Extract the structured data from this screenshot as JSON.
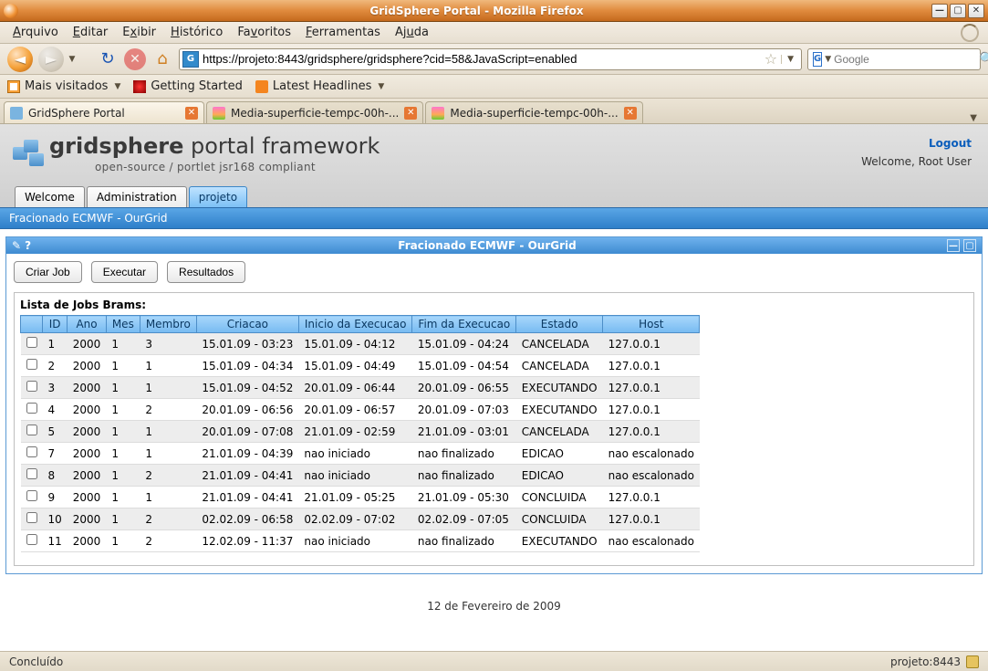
{
  "window": {
    "title": "GridSphere Portal - Mozilla Firefox"
  },
  "menu": [
    "Arquivo",
    "Editar",
    "Exibir",
    "Histórico",
    "Favoritos",
    "Ferramentas",
    "Ajuda"
  ],
  "url": "https://projeto:8443/gridsphere/gridsphere?cid=58&JavaScript=enabled",
  "search": {
    "placeholder": "Google"
  },
  "bookmarks": {
    "most": "Mais visitados",
    "started": "Getting Started",
    "headlines": "Latest Headlines"
  },
  "tabs": [
    {
      "label": "GridSphere Portal"
    },
    {
      "label": "Media-superficie-tempc-00h-..."
    },
    {
      "label": "Media-superficie-tempc-00h-..."
    }
  ],
  "gs": {
    "title_bold": "gridsphere",
    "title_rest": " portal framework",
    "subtitle": "open-source / portlet jsr168 compliant",
    "logout": "Logout",
    "welcome": "Welcome, Root User",
    "nav": [
      "Welcome",
      "Administration",
      "projeto"
    ],
    "nav_active": 2,
    "breadcrumb": "Fracionado ECMWF - OurGrid"
  },
  "portlet": {
    "title": "Fracionado ECMWF - OurGrid",
    "buttons": [
      "Criar Job",
      "Executar",
      "Resultados"
    ],
    "list_label": "Lista de Jobs Brams:",
    "headers": [
      "",
      "ID",
      "Ano",
      "Mes",
      "Membro",
      "Criacao",
      "Inicio da Execucao",
      "Fim da Execucao",
      "Estado",
      "Host"
    ],
    "rows": [
      {
        "id": "1",
        "ano": "2000",
        "mes": "1",
        "membro": "3",
        "criacao": "15.01.09 - 03:23",
        "inicio": "15.01.09 - 04:12",
        "fim": "15.01.09 - 04:24",
        "estado": "CANCELADA",
        "host": "127.0.0.1"
      },
      {
        "id": "2",
        "ano": "2000",
        "mes": "1",
        "membro": "1",
        "criacao": "15.01.09 - 04:34",
        "inicio": "15.01.09 - 04:49",
        "fim": "15.01.09 - 04:54",
        "estado": "CANCELADA",
        "host": "127.0.0.1"
      },
      {
        "id": "3",
        "ano": "2000",
        "mes": "1",
        "membro": "1",
        "criacao": "15.01.09 - 04:52",
        "inicio": "20.01.09 - 06:44",
        "fim": "20.01.09 - 06:55",
        "estado": "EXECUTANDO",
        "host": "127.0.0.1"
      },
      {
        "id": "4",
        "ano": "2000",
        "mes": "1",
        "membro": "2",
        "criacao": "20.01.09 - 06:56",
        "inicio": "20.01.09 - 06:57",
        "fim": "20.01.09 - 07:03",
        "estado": "EXECUTANDO",
        "host": "127.0.0.1"
      },
      {
        "id": "5",
        "ano": "2000",
        "mes": "1",
        "membro": "1",
        "criacao": "20.01.09 - 07:08",
        "inicio": "21.01.09 - 02:59",
        "fim": "21.01.09 - 03:01",
        "estado": "CANCELADA",
        "host": "127.0.0.1"
      },
      {
        "id": "7",
        "ano": "2000",
        "mes": "1",
        "membro": "1",
        "criacao": "21.01.09 - 04:39",
        "inicio": "nao iniciado",
        "fim": "nao finalizado",
        "estado": "EDICAO",
        "host": "nao escalonado"
      },
      {
        "id": "8",
        "ano": "2000",
        "mes": "1",
        "membro": "2",
        "criacao": "21.01.09 - 04:41",
        "inicio": "nao iniciado",
        "fim": "nao finalizado",
        "estado": "EDICAO",
        "host": "nao escalonado"
      },
      {
        "id": "9",
        "ano": "2000",
        "mes": "1",
        "membro": "1",
        "criacao": "21.01.09 - 04:41",
        "inicio": "21.01.09 - 05:25",
        "fim": "21.01.09 - 05:30",
        "estado": "CONCLUIDA",
        "host": "127.0.0.1"
      },
      {
        "id": "10",
        "ano": "2000",
        "mes": "1",
        "membro": "2",
        "criacao": "02.02.09 - 06:58",
        "inicio": "02.02.09 - 07:02",
        "fim": "02.02.09 - 07:05",
        "estado": "CONCLUIDA",
        "host": "127.0.0.1"
      },
      {
        "id": "11",
        "ano": "2000",
        "mes": "1",
        "membro": "2",
        "criacao": "12.02.09 - 11:37",
        "inicio": "nao iniciado",
        "fim": "nao finalizado",
        "estado": "EXECUTANDO",
        "host": "nao escalonado"
      }
    ]
  },
  "footer_date": "12 de Fevereiro de 2009",
  "status": {
    "left": "Concluído",
    "right": "projeto:8443"
  }
}
